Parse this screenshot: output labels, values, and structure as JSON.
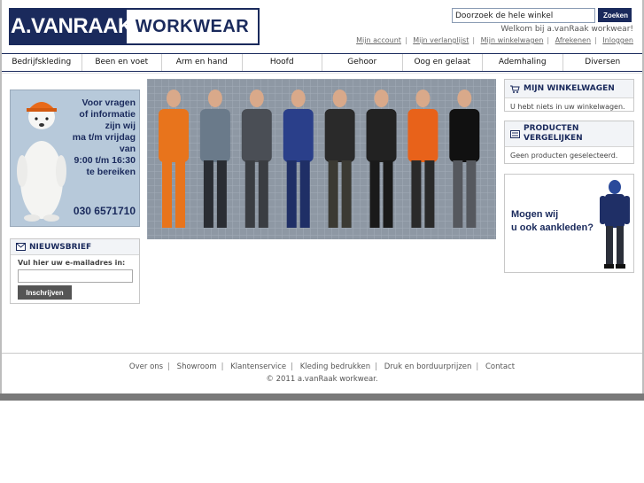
{
  "logo": {
    "left": "A.VANRAAK",
    "right": "WORKWEAR"
  },
  "search": {
    "placeholder": "Doorzoek de hele winkel",
    "value": "Doorzoek de hele winkel",
    "button": "Zoeken"
  },
  "header": {
    "welcome": "Welkom bij a.vanRaak workwear!",
    "links": [
      "Mijn account",
      "Mijn verlanglijst",
      "Mijn winkelwagen",
      "Afrekenen",
      "Inloggen"
    ]
  },
  "nav": [
    "Bedrijfskleding",
    "Been en voet",
    "Arm en hand",
    "Hoofd",
    "Gehoor",
    "Oog en gelaat",
    "Ademhaling",
    "Diversen"
  ],
  "contact": {
    "lines": [
      "Voor vragen",
      "of informatie",
      "zijn wij",
      "ma t/m vrijdag",
      "van",
      "9:00 t/m 16:30",
      "te bereiken"
    ],
    "phone": "030 6571710"
  },
  "newsletter": {
    "title": "NIEUWSBRIEF",
    "label": "Vul hier uw e-mailadres in:",
    "button": "Inschrijven"
  },
  "cart": {
    "title": "MIJN WINKELWAGEN",
    "text": "U hebt niets in uw winkelwagen."
  },
  "compare": {
    "title_line1": "PRODUCTEN",
    "title_line2": "VERGELIJKEN",
    "text": "Geen producten geselecteerd."
  },
  "promo": {
    "line1": "Mogen wij",
    "line2": "u ook aankleden?"
  },
  "footer": {
    "links": [
      "Over ons",
      "Showroom",
      "Klantenservice",
      "Kleding bedrukken",
      "Druk en borduurprijzen",
      "Contact"
    ],
    "copyright": "© 2011 a.vanRaak workwear."
  },
  "colors": {
    "brand": "#1a2a5c",
    "hero_bg": "#8c96a2",
    "contact_bg": "#b7c9da"
  }
}
